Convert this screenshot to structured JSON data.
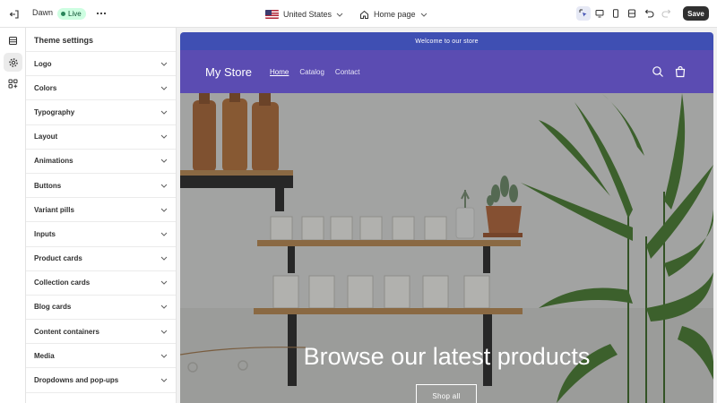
{
  "topbar": {
    "theme_name": "Dawn",
    "status_badge": "Live",
    "country": "United States",
    "page": "Home page",
    "save_label": "Save"
  },
  "sidebar": {
    "title": "Theme settings",
    "items": [
      {
        "label": "Logo"
      },
      {
        "label": "Colors"
      },
      {
        "label": "Typography"
      },
      {
        "label": "Layout"
      },
      {
        "label": "Animations"
      },
      {
        "label": "Buttons"
      },
      {
        "label": "Variant pills"
      },
      {
        "label": "Inputs"
      },
      {
        "label": "Product cards"
      },
      {
        "label": "Collection cards"
      },
      {
        "label": "Blog cards"
      },
      {
        "label": "Content containers"
      },
      {
        "label": "Media"
      },
      {
        "label": "Dropdowns and pop-ups"
      }
    ]
  },
  "preview": {
    "announcement": "Welcome to our store",
    "store_name": "My Store",
    "nav": [
      "Home",
      "Catalog",
      "Contact"
    ],
    "hero_title": "Browse our latest products",
    "hero_button": "Shop all"
  },
  "colors": {
    "announcement_bg": "#3f4fb3",
    "header_bg": "#5b4cb2",
    "live_badge_bg": "#cdfee1",
    "save_button_bg": "#303030"
  }
}
